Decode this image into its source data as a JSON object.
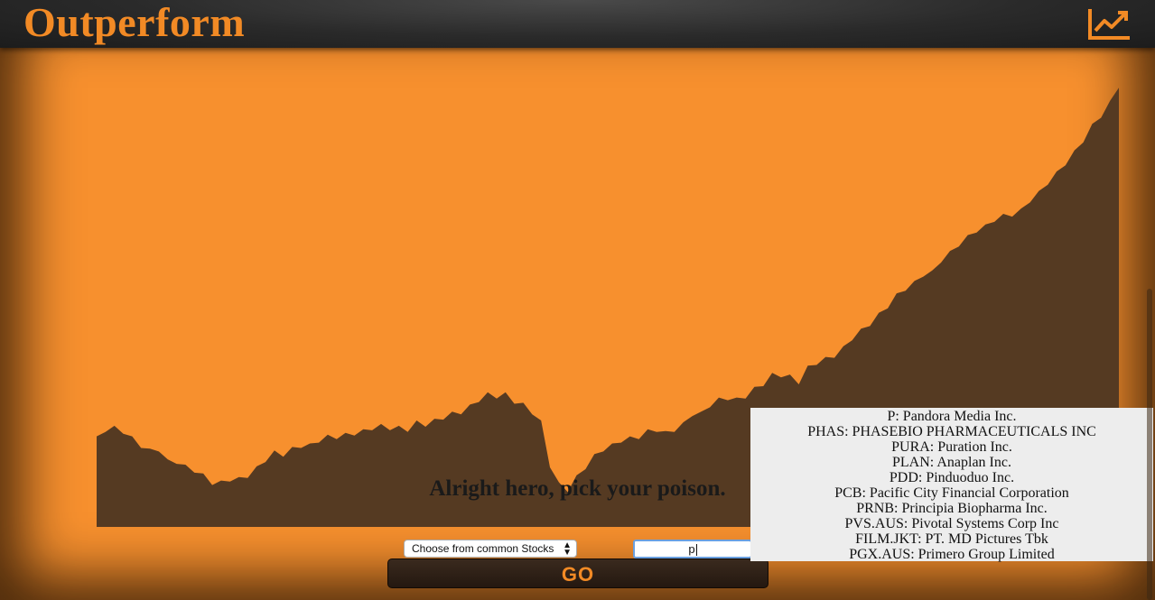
{
  "app": {
    "title": "Outperform",
    "colors": {
      "brand": "#f28a25",
      "background": "#f7902e",
      "chart_fill": "#553a22"
    }
  },
  "header": {
    "chart_icon": "trending-up-chart-icon"
  },
  "main": {
    "headline": "Alright hero, pick your poison.",
    "stock_select": {
      "selected": "Choose from common Stocks"
    },
    "search": {
      "value": "p"
    },
    "go_label": "GO"
  },
  "suggestions": [
    "P: Pandora Media Inc.",
    "PHAS: PHASEBIO PHARMACEUTICALS INC",
    "PURA: Puration Inc.",
    "PLAN: Anaplan Inc.",
    "PDD: Pinduoduo Inc.",
    "PCB: Pacific City Financial Corporation",
    "PRNB: Principia Biopharma Inc.",
    "PVS.AUS: Pivotal Systems Corp Inc",
    "FILM.JKT: PT. MD Pictures Tbk",
    "PGX.AUS: Primero Group Limited"
  ],
  "chart_data": {
    "type": "area",
    "title": "",
    "xlabel": "",
    "ylabel": "",
    "grid": false,
    "values": [
      50,
      55,
      56,
      54,
      50,
      46,
      43,
      44,
      37,
      37,
      34,
      32,
      29,
      25,
      25,
      27,
      27,
      29,
      33,
      38,
      42,
      41,
      44,
      46,
      46,
      49,
      51,
      51,
      52,
      53,
      54,
      56,
      57,
      56,
      56,
      55,
      59,
      58,
      60,
      62,
      64,
      65,
      68,
      72,
      75,
      74,
      75,
      71,
      69,
      65,
      59,
      35,
      24,
      21,
      28,
      34,
      40,
      44,
      46,
      49,
      50,
      51,
      54,
      55,
      53,
      55,
      58,
      64,
      64,
      69,
      72,
      73,
      72,
      74,
      78,
      81,
      86,
      86,
      85,
      82,
      90,
      93,
      95,
      97,
      101,
      107,
      111,
      115,
      120,
      125,
      131,
      135,
      138,
      143,
      144,
      151,
      155,
      160,
      164,
      168,
      170,
      174,
      176,
      177,
      179,
      185,
      189,
      195,
      200,
      206,
      212,
      219,
      227,
      233,
      240,
      250
    ]
  }
}
